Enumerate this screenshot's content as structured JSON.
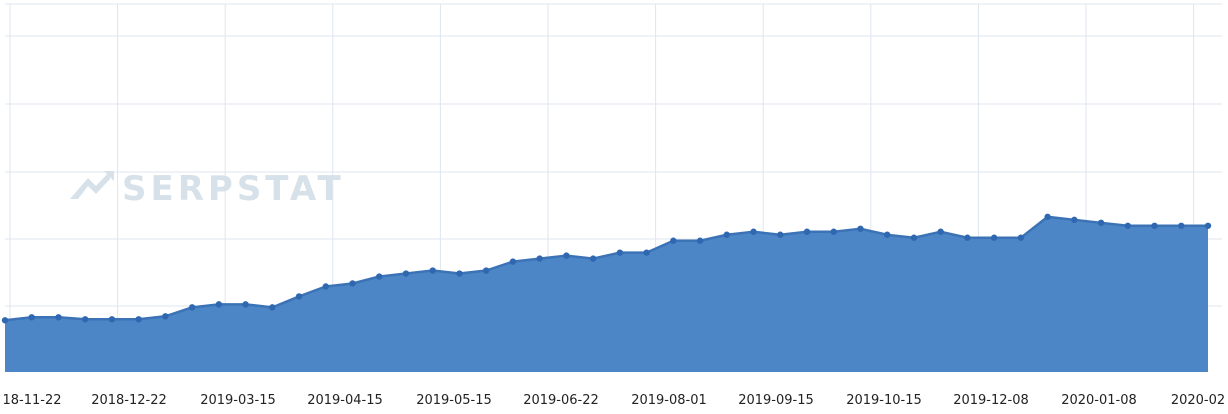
{
  "watermark": {
    "text": "SERPSTAT",
    "color": "#d7e1ea"
  },
  "colors": {
    "area": "#4c86c6",
    "line": "#3b73b6",
    "point": "#2f68b0",
    "grid": "#dfe5ef"
  },
  "chart_data": {
    "type": "area",
    "title": "",
    "xlabel": "",
    "ylabel": "",
    "grid": true,
    "legend": "none",
    "x_ticks": [
      "18-11-22",
      "2018-12-22",
      "2019-03-15",
      "2019-04-15",
      "2019-05-15",
      "2019-06-22",
      "2019-08-01",
      "2019-09-15",
      "2019-10-15",
      "2019-12-08",
      "2020-01-08",
      "2020-02"
    ],
    "values": [
      52,
      55,
      55,
      53,
      53,
      53,
      56,
      65,
      68,
      68,
      65,
      76,
      86,
      89,
      96,
      99,
      102,
      99,
      102,
      111,
      114,
      117,
      114,
      120,
      120,
      132,
      132,
      138,
      141,
      138,
      141,
      141,
      144,
      138,
      135,
      141,
      135,
      135,
      135,
      156,
      153,
      150,
      147,
      147,
      147,
      147
    ],
    "ylim": [
      0,
      370
    ]
  }
}
